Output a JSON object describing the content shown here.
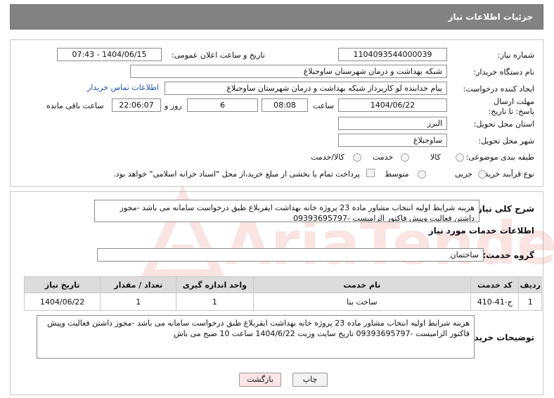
{
  "header": {
    "title": "جزئیات اطلاعات نیاز"
  },
  "fields": {
    "need_number": {
      "label": "شماره نیاز:",
      "value": "1104093544000039"
    },
    "announce_datetime": {
      "label": "تاریخ و ساعت اعلان عمومی:",
      "value": "1404/06/15 - 07:43"
    },
    "buyer_org": {
      "label": "نام دستگاه خریدار:",
      "value": "شبکه بهداشت و درمان شهرستان ساوجبلاغ"
    },
    "requester": {
      "label": "ایجاد کننده درخواست:",
      "value": "پیام خدابنده لو کارپرداز شبکه بهداشت و درمان شهرستان ساوجبلاغ",
      "contact_link": "اطلاعات تماس خریدار"
    },
    "deadline": {
      "label": "مهلت ارسال پاسخ: تا تاریخ:",
      "date": "1404/06/22",
      "time_label": "ساعت",
      "time": "08:08",
      "days": "6",
      "days_label": "روز و",
      "remaining": "22:06:07",
      "remaining_label": "ساعت باقی مانده"
    },
    "province": {
      "label": "استان محل تحویل:",
      "value": "البرز"
    },
    "city": {
      "label": "شهر محل تحویل:",
      "value": "ساوجبلاغ"
    },
    "category": {
      "label": "طبقه بندی موضوعی:",
      "options": [
        "کالا",
        "خدمت",
        "کالا/خدمت"
      ]
    },
    "purchase_type": {
      "label": "نوع فرآیند خرید :",
      "options": [
        "جزیی",
        "متوسط"
      ],
      "note": "پرداخت تمام یا بخشی از مبلغ خرید،از محل \"اسناد خزانه اسلامی\" خواهد بود."
    }
  },
  "description": {
    "label": "شرح کلی نیاز:",
    "text": "هزینه شرایط اولیه انتخاب مشاور ماده 23 پروژه خانه بهداشت ایقربلاغ طبق درخواست سامانه می باشد -مجوز داشتن فعالیت وپیش فاکتور  الزامیست -09393695797"
  },
  "services": {
    "section_title": "اطلاعات خدمات مورد نیاز",
    "group_label": "گروه خدمت:",
    "group_value": "ساختمان",
    "columns": [
      "ردیف",
      "کد خدمت",
      "نام خدمت",
      "واحد اندازه گیری",
      "تعداد / مقدار",
      "تاریخ نیاز"
    ],
    "rows": [
      [
        "1",
        "ج-41-410",
        "ساخت بنا",
        "1",
        "1",
        "1404/06/22"
      ]
    ]
  },
  "buyer_notes": {
    "label": "توضیحات خریدار:",
    "text": "هزینه شرایط اولیه انتخاب مشاور ماده 23 پروژه خانه بهداشت ایقربلاغ طبق درخواست سامانه می باشد -مجوز داشتن فعالیت وپیش فاکتور  الزامیست -09393695797 تاریخ سایت وزیت 1404/6/22 ساعت 10 صبح می باش"
  },
  "buttons": {
    "print": "چاپ",
    "back": "بازگشت"
  },
  "watermark": {
    "text": "AriaTender.neT"
  },
  "colors": {
    "title_bg": "#828282",
    "link": "#1a4fb5",
    "back_btn_bg": "#fbe3e6",
    "watermark": "#d33a2c"
  }
}
